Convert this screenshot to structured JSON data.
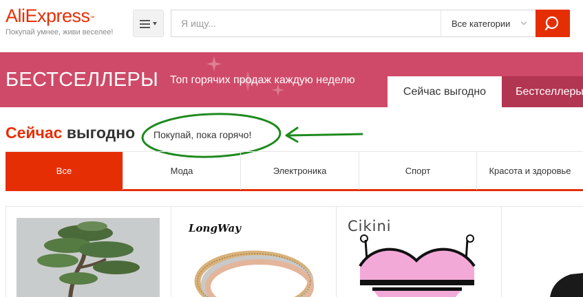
{
  "header": {
    "logo": {
      "brand": "AliExpress",
      "trademark": "™",
      "slogan": "Покупай умнее, живи веселее!"
    },
    "menu_button": {
      "icon": "hamburger-menu-icon"
    },
    "search": {
      "placeholder": "Я ищу...",
      "value": "",
      "category": "Все категории",
      "button_icon": "search-icon"
    }
  },
  "banner": {
    "title": "БЕСТСЕЛЛЕРЫ",
    "subtitle": "Топ горячих продаж каждую неделю",
    "tabs": [
      {
        "label": "Сейчас выгодно",
        "active": true
      },
      {
        "label": "Бестселлеры",
        "active": false
      }
    ]
  },
  "section": {
    "title_part1": "Сейчас",
    "title_part2": "выгодно",
    "slogan": "Покупай, пока горячо!"
  },
  "categories": [
    {
      "label": "Все",
      "active": true
    },
    {
      "label": "Мода",
      "active": false
    },
    {
      "label": "Электроника",
      "active": false
    },
    {
      "label": "Спорт",
      "active": false
    },
    {
      "label": "Красота и здоровье",
      "active": false
    }
  ],
  "products": [
    {
      "image": "bonsai-tree-image"
    },
    {
      "brand": "LongWay",
      "image": "bracelets-image"
    },
    {
      "brand": "Cikini",
      "image": "swimsuit-image"
    },
    {
      "image": "dark-clothing-image"
    }
  ],
  "colors": {
    "brand_red": "#e62e04",
    "banner_pink": "#cf4a68",
    "banner_tab_dark": "#b23552",
    "annotation_green": "#1e8a1e"
  }
}
